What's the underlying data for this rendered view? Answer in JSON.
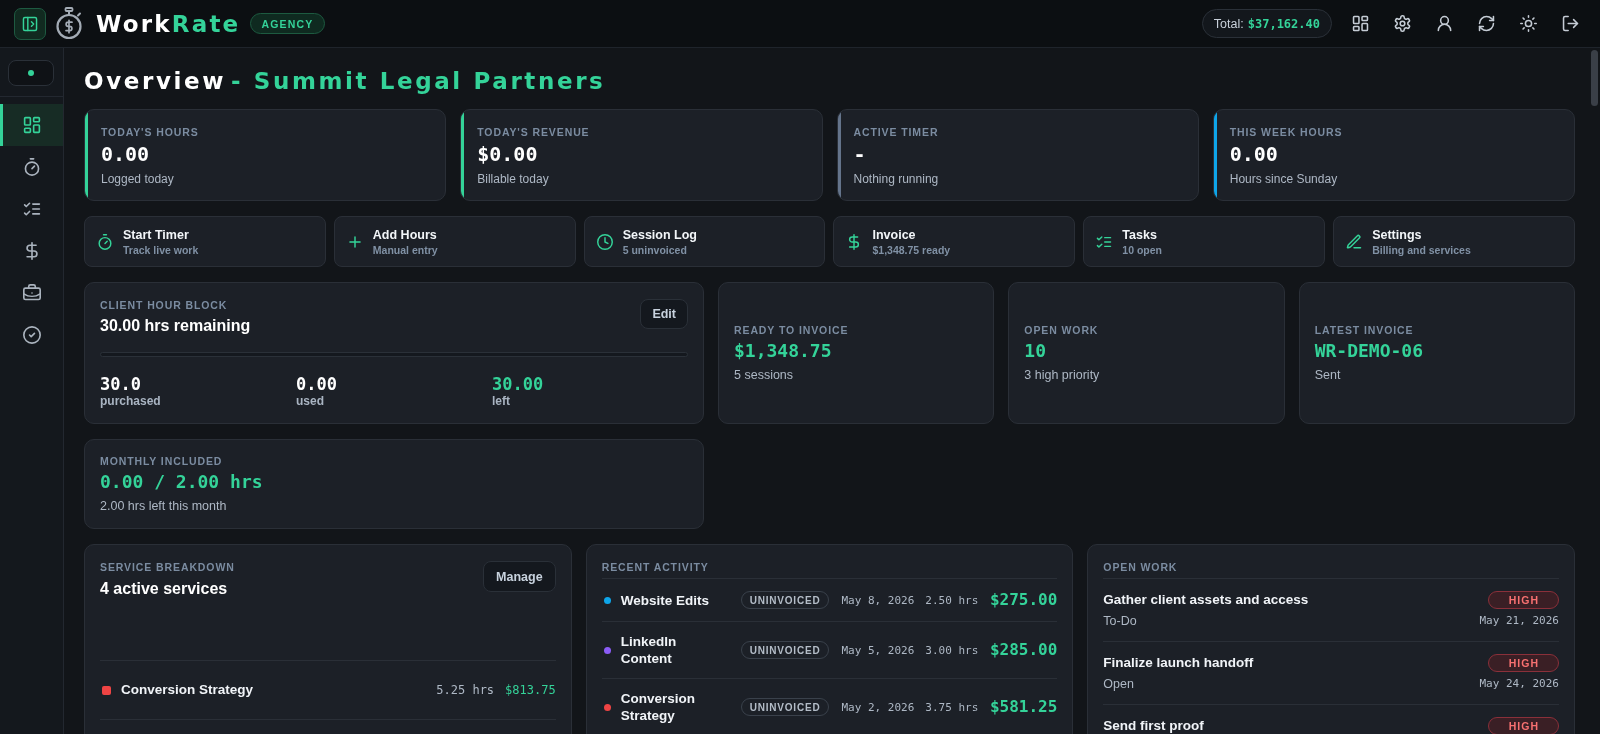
{
  "topbar": {
    "brand": {
      "text": "Work",
      "accent": "Rate"
    },
    "plan_badge": "AGENCY",
    "total": {
      "label": "Total:",
      "amount": "$37,162.40"
    }
  },
  "sidebar": {
    "status": {
      "online": true
    },
    "nav_items": [
      {
        "selected": true
      },
      {
        "selected": false
      },
      {
        "selected": false
      },
      {
        "selected": false
      },
      {
        "selected": false
      },
      {
        "selected": false
      }
    ]
  },
  "page_title": {
    "text": "Overview",
    "accent": "- Summit Legal Partners"
  },
  "stat_cards": [
    {
      "label": "TODAY'S HOURS",
      "value": "0.00",
      "note": "Logged today",
      "color": "#34d399"
    },
    {
      "label": "TODAY'S REVENUE",
      "value": "$0.00",
      "note": "Billable today",
      "color": "#34d399"
    },
    {
      "label": "ACTIVE TIMER",
      "value": "-",
      "note": "Nothing running",
      "color": "#64748b"
    },
    {
      "label": "THIS WEEK HOURS",
      "value": "0.00",
      "note": "Hours since Sunday",
      "color": "#0ea5e9"
    }
  ],
  "quick_actions": [
    {
      "title": "Start Timer",
      "subtitle": "Track live work"
    },
    {
      "title": "Add Hours",
      "subtitle": "Manual entry"
    },
    {
      "title": "Session Log",
      "subtitle": "5 uninvoiced"
    },
    {
      "title": "Invoice",
      "subtitle": "$1,348.75 ready"
    },
    {
      "title": "Tasks",
      "subtitle": "10 open"
    },
    {
      "title": "Settings",
      "subtitle": "Billing and services"
    }
  ],
  "hour_block": {
    "label": "CLIENT HOUR BLOCK",
    "headline": "30.00 hrs remaining",
    "edit_button": "Edit",
    "level": 0,
    "stats": [
      {
        "value": "30.0",
        "caption": "purchased",
        "highlighted": false
      },
      {
        "value": "0.00",
        "caption": "used",
        "highlighted": false
      },
      {
        "value": "30.00",
        "caption": "left",
        "highlighted": true
      }
    ]
  },
  "summary_cards": [
    {
      "label": "READY TO INVOICE",
      "value": "$1,348.75",
      "note": "5 sessions"
    },
    {
      "label": "OPEN WORK",
      "value": "10",
      "note": "3 high priority"
    },
    {
      "label": "LATEST INVOICE",
      "value": "WR-DEMO-06",
      "note": "Sent"
    }
  ],
  "monthly_included": {
    "label": "MONTHLY INCLUDED",
    "value": "0.00 / 2.00 hrs",
    "note": "2.00 hrs left this month"
  },
  "service_breakdown": {
    "label": "SERVICE BREAKDOWN",
    "headline": "4 active services",
    "manage_button": "Manage",
    "services": [
      {
        "name": "Conversion Strategy",
        "hours": "5.25 hrs",
        "amount": "$813.75",
        "color": "#ef4444"
      }
    ]
  },
  "recent_activity": {
    "label": "RECENT ACTIVITY",
    "entries": [
      {
        "name": "Website Edits",
        "status": "UNINVOICED",
        "date": "May 8, 2026",
        "hours": "2.50 hrs",
        "amount": "$275.00",
        "color": "#0ea5e9"
      },
      {
        "name": "LinkedIn Content",
        "status": "UNINVOICED",
        "date": "May 5, 2026",
        "hours": "3.00 hrs",
        "amount": "$285.00",
        "color": "#8b5cf6"
      },
      {
        "name": "Conversion Strategy",
        "status": "UNINVOICED",
        "date": "May 2, 2026",
        "hours": "3.75 hrs",
        "amount": "$581.25",
        "color": "#ef4444"
      }
    ]
  },
  "open_work": {
    "label": "OPEN WORK",
    "tasks": [
      {
        "title": "Gather client assets and access",
        "status": "To-Do",
        "priority": "HIGH",
        "due": "May 21, 2026"
      },
      {
        "title": "Finalize launch handoff",
        "status": "Open",
        "priority": "HIGH",
        "due": "May 24, 2026"
      },
      {
        "title": "Send first proof",
        "priority": "HIGH"
      }
    ]
  }
}
